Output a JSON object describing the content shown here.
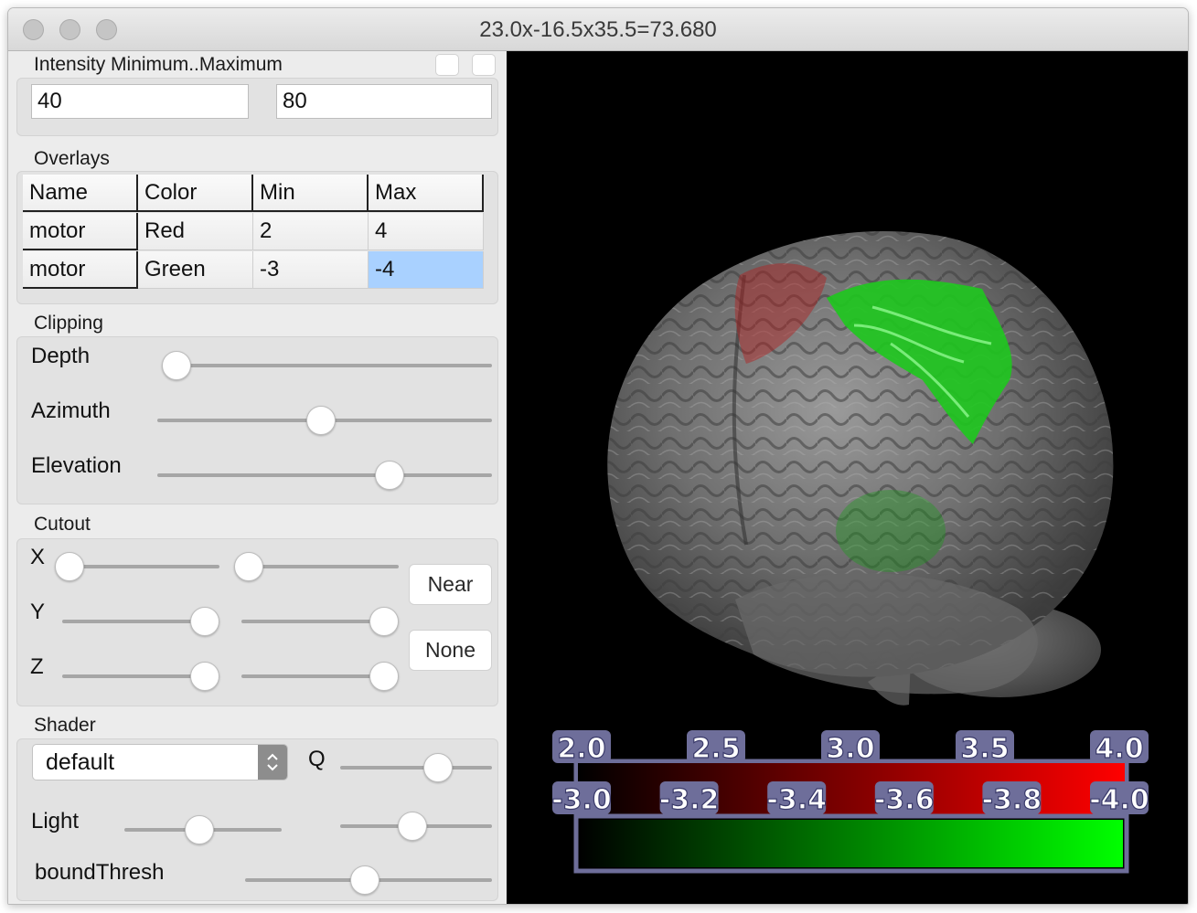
{
  "window": {
    "title": "23.0x-16.5x35.5=73.680"
  },
  "intensity": {
    "title": "Intensity Minimum..Maximum",
    "min": "40",
    "max": "80"
  },
  "overlays": {
    "title": "Overlays",
    "headers": [
      "Name",
      "Color",
      "Min",
      "Max"
    ],
    "rows": [
      [
        "motor",
        "Red",
        "2",
        "4"
      ],
      [
        "motor",
        "Green",
        "-3",
        "-4"
      ]
    ]
  },
  "clipping": {
    "title": "Clipping",
    "depth_label": "Depth",
    "depth_value": 0.0,
    "azimuth_label": "Azimuth",
    "azimuth_value": 0.5,
    "elevation_label": "Elevation",
    "elevation_value": 0.72
  },
  "cutout": {
    "title": "Cutout",
    "x_label": "X",
    "y_label": "Y",
    "z_label": "Z",
    "x_values": [
      0.0,
      0.0
    ],
    "y_values": [
      1.0,
      1.0
    ],
    "z_values": [
      1.0,
      1.0
    ],
    "near_label": "Near",
    "none_label": "None"
  },
  "shader": {
    "title": "Shader",
    "selected": "default",
    "q_label": "Q",
    "q_value": 0.7,
    "light_label": "Light",
    "light_values": [
      0.5,
      0.5
    ],
    "boundthresh_label": "boundThresh",
    "boundthresh_value": 0.5
  },
  "colorbar": {
    "red_labels": [
      "2.0",
      "2.5",
      "3.0",
      "3.5",
      "4.0"
    ],
    "green_labels": [
      "-3.0",
      "-3.2",
      "-3.4",
      "-3.6",
      "-3.8",
      "-4.0"
    ],
    "red_color": "#ff0000",
    "green_color": "#00ff00",
    "frame_color": "#6e6e9a"
  }
}
